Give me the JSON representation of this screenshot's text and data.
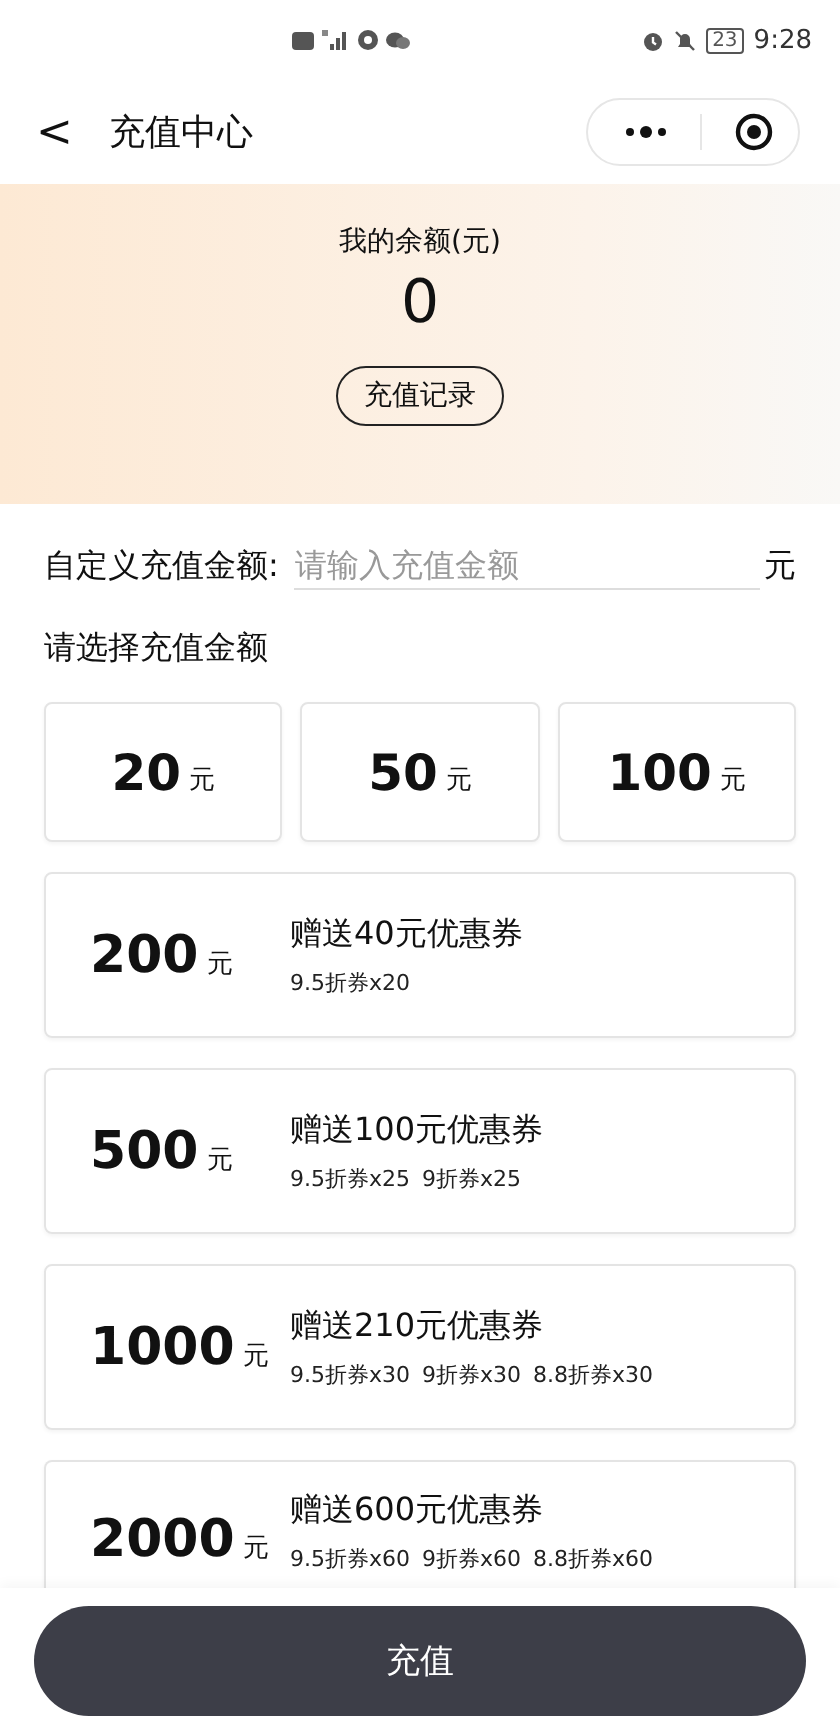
{
  "status_bar": {
    "battery": "23",
    "time": "9:28"
  },
  "nav": {
    "back": "<",
    "title": "充值中心"
  },
  "balance": {
    "label": "我的余额(元)",
    "value": "0",
    "history_button": "充值记录"
  },
  "custom": {
    "label": "自定义充值金额:",
    "placeholder": "请输入充值金额",
    "unit": "元"
  },
  "section_title": "请选择充值金额",
  "quick_amounts": [
    {
      "amount": "20",
      "unit": "元"
    },
    {
      "amount": "50",
      "unit": "元"
    },
    {
      "amount": "100",
      "unit": "元"
    }
  ],
  "packages": [
    {
      "amount": "200",
      "unit": "元",
      "bonus": "赠送40元优惠券",
      "coupons": [
        "9.5折券x20"
      ]
    },
    {
      "amount": "500",
      "unit": "元",
      "bonus": "赠送100元优惠券",
      "coupons": [
        "9.5折券x25",
        "9折券x25"
      ]
    },
    {
      "amount": "1000",
      "unit": "元",
      "bonus": "赠送210元优惠券",
      "coupons": [
        "9.5折券x30",
        "9折券x30",
        "8.8折券x30"
      ]
    },
    {
      "amount": "2000",
      "unit": "元",
      "bonus": "赠送600元优惠券",
      "coupons": [
        "9.5折券x60",
        "9折券x60",
        "8.8折券x60"
      ]
    }
  ],
  "submit_button": "充值"
}
